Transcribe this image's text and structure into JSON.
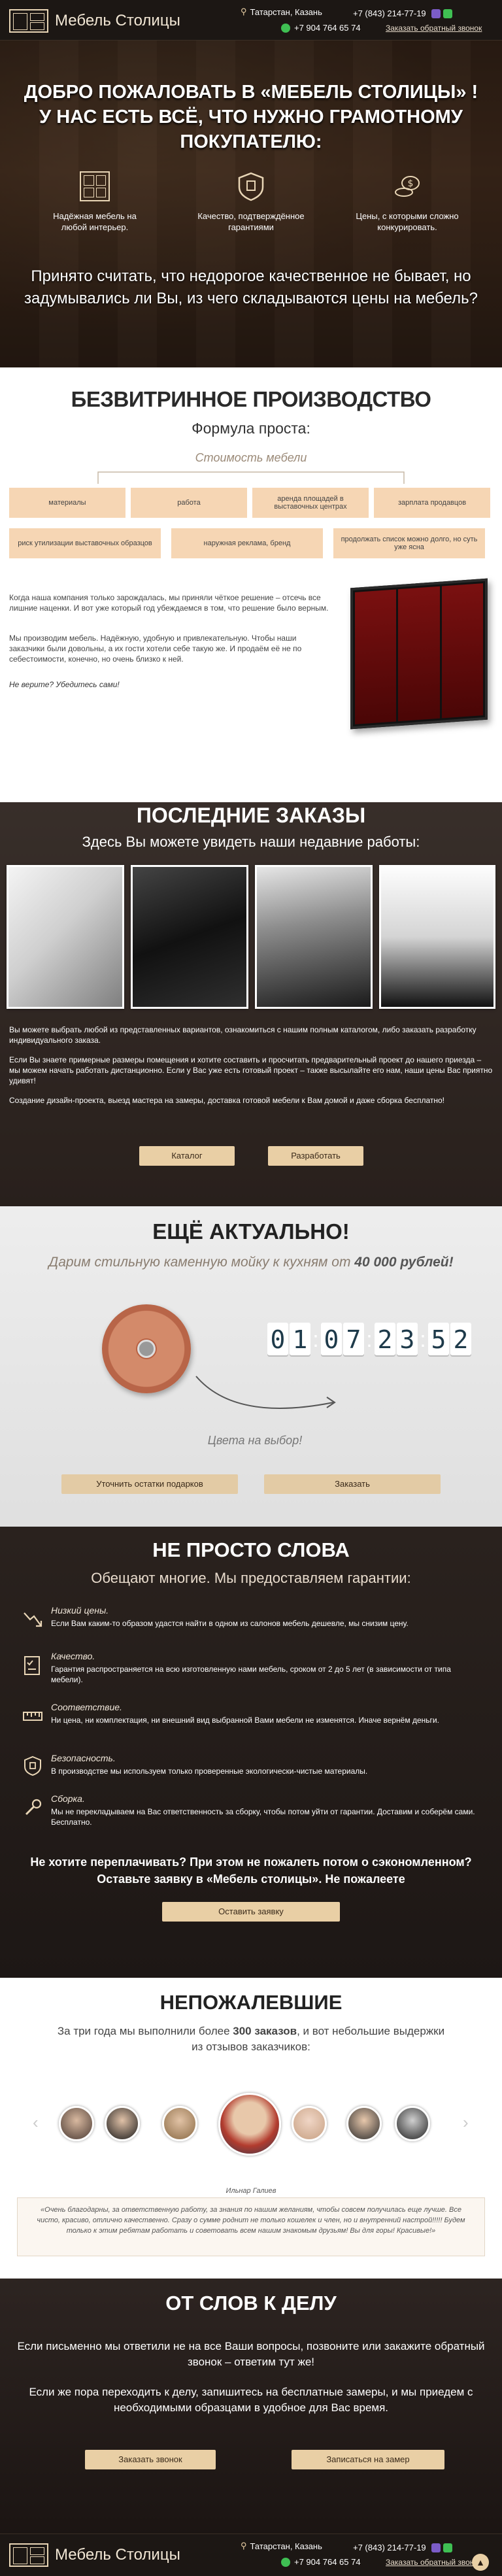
{
  "header": {
    "logo_text": "Мебель Столицы",
    "address": "Татарстан, Казань",
    "phone1": "+7 (843) 214-77-19",
    "phone2": "+7 904 764 65 74",
    "callback_link": "Заказать обратный звонок"
  },
  "hero": {
    "title": "ДОБРО ПОЖАЛОВАТЬ В «МЕБЕЛЬ СТОЛИЦЫ» ! У НАС ЕСТЬ ВСЁ, ЧТО НУЖНО ГРАМОТНОМУ ПОКУПАТЕЛЮ:",
    "features": [
      {
        "icon": "shelves-icon",
        "text": "Надёжная мебель на любой интерьер."
      },
      {
        "icon": "shield-icon",
        "text": "Качество, подтверждённое гарантиями"
      },
      {
        "icon": "coins-icon",
        "text": "Цены, с которыми сложно конкурировать."
      }
    ],
    "subtitle": "Принято считать, что недорогое качественное не бывает, но задумывались ли Вы, из чего складываются цены на мебель?"
  },
  "production": {
    "title": "БЕЗВИТРИННОЕ ПРОИЗВОДСТВО",
    "subtitle": "Формула проста:",
    "price_label": "Стоимость мебели",
    "cards_row1": [
      "материалы",
      "работа",
      "аренда площадей в выставочных центрах",
      "зарплата продавцов"
    ],
    "cards_row2": [
      "риск утилизации выставочных образцов",
      "наружная реклама, бренд",
      "продолжать список можно долго, но суть уже ясна"
    ],
    "para1": "Когда наша компания только зарождалась, мы приняли чёткое решение – отсечь все лишние наценки. И вот уже который год убеждаемся в том, что решение было верным.",
    "para2": "Мы производим мебель. Надёжную, удобную и привлекательную. Чтобы наши заказчики были довольны, а их гости хотели себе такую же. И продаём её не по себестоимости, конечно, но очень близко к ней.",
    "para3": "Не верите? Убедитесь сами!"
  },
  "orders": {
    "title": "ПОСЛЕДНИЕ ЗАКАЗЫ",
    "subtitle": "Здесь Вы можете увидеть наши недавние работы:",
    "para1": "Вы можете выбрать любой из представленных вариантов, ознакомиться с нашим полным каталогом, либо заказать разработку индивидуального заказа.",
    "para2": "Если Вы знаете примерные размеры помещения и хотите составить и просчитать предварительный проект до нашего приезда – мы можем начать работать дистанционно. Если у Вас уже есть готовый проект – также высылайте его нам, наши цены Вас приятно удивят!",
    "para3": "Создание дизайн-проекта, выезд мастера на замеры, доставка готовой мебели к Вам домой и даже сборка бесплатно!",
    "btn_catalog": "Каталог",
    "btn_develop": "Разработать"
  },
  "offer": {
    "title": "ЕЩЁ АКТУАЛЬНО!",
    "subtitle_prefix": "Дарим стильную каменную мойку к кухням от ",
    "subtitle_amount": "40 000 рублей!",
    "timer": [
      "0",
      "1",
      "0",
      "7",
      "2",
      "3",
      "5",
      "2"
    ],
    "caption": "Цвета на выбор!",
    "btn_gifts": "Уточнить остатки подарков",
    "btn_order": "Заказать"
  },
  "guarantees": {
    "title": "НЕ ПРОСТО СЛОВА",
    "subtitle": "Обещают многие. Мы предоставляем гарантии:",
    "items": [
      {
        "icon": "chart-down-icon",
        "title": "Низкий цены.",
        "text": "Если Вам каким-то образом удастся найти в одном из салонов мебель дешевле, мы снизим цену."
      },
      {
        "icon": "checklist-icon",
        "title": "Качество.",
        "text": "Гарантия распространяется на всю изготовленную нами мебель, сроком от 2 до 5 лет (в зависимости от типа мебели)."
      },
      {
        "icon": "ruler-icon",
        "title": "Соответствие.",
        "text": "Ни цена, ни комплектация, ни внешний вид выбранной Вами мебели не изменятся. Иначе вернём деньги."
      },
      {
        "icon": "shield-icon",
        "title": "Безопасность.",
        "text": "В производстве мы используем только проверенные экологически-чистые материалы."
      },
      {
        "icon": "wrench-icon",
        "title": "Сборка.",
        "text": "Мы не перекладываем на Вас ответственность за сборку, чтобы потом уйти от гарантии. Доставим и соберём сами. Бесплатно."
      }
    ],
    "cta": "Не хотите переплачивать? При этом не пожалеть потом о сэкономленном? Оставьте заявку в «Мебель столицы». Не пожалеете",
    "btn": "Оставить заявку"
  },
  "reviews": {
    "title": "НЕПОЖАЛЕВШИЕ",
    "subtitle_prefix": "За три года мы выполнили более ",
    "subtitle_count": "300 заказов",
    "subtitle_suffix": ", и вот небольшие выдержки из отзывов заказчиков:",
    "reviewer": "Ильнар Галиев",
    "text": "«Очень благодарны, за ответственную работу, за знания по нашим желаниям, чтобы совсем получилась еще лучше. Все чисто, красиво, отлично качественно. Сразу о сумме роднит не только кошелек и член, но и внутренний настрой!!!!! Будем только к этим ребятам работать и советовать всем нашим знакомым друзьям! Вы для горы! Красивые!»"
  },
  "contact": {
    "title": "ОТ СЛОВ К ДЕЛУ",
    "text1": "Если письменно мы ответили не на все Ваши вопросы, позвоните или закажите обратный звонок – ответим тут же!",
    "text2": "Если же пора переходить к делу, запишитесь на бесплатные замеры, и мы приедем с необходимыми образцами в удобное для Вас время.",
    "btn_call": "Заказать звонок",
    "btn_measure": "Записаться на замер"
  },
  "footer": {
    "logo_text": "Мебель Столицы",
    "address": "Татарстан, Казань",
    "phone1": "+7 (843) 214-77-19",
    "phone2": "+7 904 764 65 74",
    "callback_link": "Заказать обратный звонок"
  }
}
